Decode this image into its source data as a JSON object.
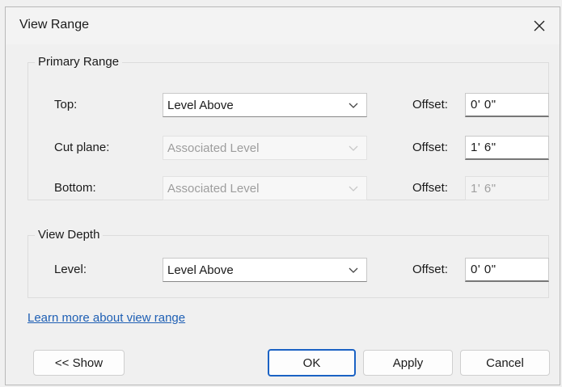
{
  "dialog": {
    "title": "View Range"
  },
  "primary_range": {
    "legend": "Primary Range",
    "rows": [
      {
        "label": "Top:",
        "combo_value": "Level Above",
        "combo_enabled": true,
        "offset_label": "Offset:",
        "offset_value": "0' 0\"",
        "offset_enabled": true
      },
      {
        "label": "Cut plane:",
        "combo_value": "Associated Level",
        "combo_enabled": false,
        "offset_label": "Offset:",
        "offset_value": "1' 6\"",
        "offset_enabled": true
      },
      {
        "label": "Bottom:",
        "combo_value": "Associated Level",
        "combo_enabled": false,
        "offset_label": "Offset:",
        "offset_value": "1' 6\"",
        "offset_enabled": false
      }
    ]
  },
  "view_depth": {
    "legend": "View Depth",
    "level_label": "Level:",
    "level_value": "Level Above",
    "offset_label": "Offset:",
    "offset_value": "0' 0\""
  },
  "link": {
    "text": "Learn more about view range"
  },
  "buttons": {
    "show": "<< Show",
    "ok": "OK",
    "apply": "Apply",
    "cancel": "Cancel"
  },
  "icons": {
    "close": "close-icon",
    "dropdown": "chevron-down-icon"
  },
  "colors": {
    "link": "#1e5fb4",
    "default_button_border": "#1b62c4",
    "disabled_text": "#9d9d9d"
  }
}
